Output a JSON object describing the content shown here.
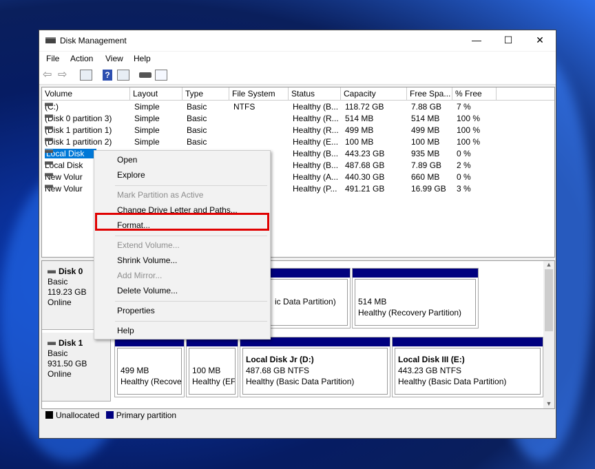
{
  "window": {
    "title": "Disk Management",
    "minimize": "—",
    "maximize": "☐",
    "close": "✕"
  },
  "menu": [
    "File",
    "Action",
    "View",
    "Help"
  ],
  "toolbar": [
    "back-icon",
    "forward-icon",
    "show-hide-tree-icon",
    "help-icon",
    "show-hide-action-pane-icon",
    "connect-icon",
    "properties-icon"
  ],
  "columns": [
    "Volume",
    "Layout",
    "Type",
    "File System",
    "Status",
    "Capacity",
    "Free Spa...",
    "% Free"
  ],
  "volumes": [
    [
      "(C:)",
      "Simple",
      "Basic",
      "NTFS",
      "Healthy (B...",
      "118.72 GB",
      "7.88 GB",
      "7 %"
    ],
    [
      "(Disk 0 partition 3)",
      "Simple",
      "Basic",
      "",
      "Healthy (R...",
      "514 MB",
      "514 MB",
      "100 %"
    ],
    [
      "(Disk 1 partition 1)",
      "Simple",
      "Basic",
      "",
      "Healthy (R...",
      "499 MB",
      "499 MB",
      "100 %"
    ],
    [
      "(Disk 1 partition 2)",
      "Simple",
      "Basic",
      "",
      "Healthy (E...",
      "100 MB",
      "100 MB",
      "100 %"
    ],
    [
      "Local Disk",
      "",
      "",
      "",
      "Healthy (B...",
      "443.23 GB",
      "935 MB",
      "0 %"
    ],
    [
      "Local Disk",
      "",
      "",
      "",
      "Healthy (B...",
      "487.68 GB",
      "7.89 GB",
      "2 %"
    ],
    [
      "New Volur",
      "",
      "",
      "",
      "Healthy (A...",
      "440.30 GB",
      "660 MB",
      "0 %"
    ],
    [
      "New Volur",
      "",
      "",
      "",
      "Healthy (P...",
      "491.21 GB",
      "16.99 GB",
      "3 %"
    ]
  ],
  "disks": [
    {
      "name": "Disk 0",
      "type": "Basic",
      "size": "119.23 GB",
      "status": "Online",
      "partitions": [
        {
          "title": "",
          "size": "",
          "status": "ic Data Partition)"
        },
        {
          "title": "",
          "size": "514 MB",
          "status": "Healthy (Recovery Partition)"
        }
      ]
    },
    {
      "name": "Disk 1",
      "type": "Basic",
      "size": "931.50 GB",
      "status": "Online",
      "partitions": [
        {
          "title": "",
          "size": "499 MB",
          "status": "Healthy (Recover"
        },
        {
          "title": "",
          "size": "100 MB",
          "status": "Healthy (EFI"
        },
        {
          "title": "Local Disk Jr  (D:)",
          "size": "487.68 GB NTFS",
          "status": "Healthy (Basic Data Partition)"
        },
        {
          "title": "Local Disk III  (E:)",
          "size": "443.23 GB NTFS",
          "status": "Healthy (Basic Data Partition)"
        }
      ]
    }
  ],
  "legend": [
    {
      "label": "Unallocated",
      "color": "#000000"
    },
    {
      "label": "Primary partition",
      "color": "#00007f"
    }
  ],
  "context_menu": [
    {
      "label": "Open",
      "enabled": true
    },
    {
      "label": "Explore",
      "enabled": true
    },
    {
      "label": "Mark Partition as Active",
      "enabled": false
    },
    {
      "label": "Change Drive Letter and Paths...",
      "enabled": true
    },
    {
      "label": "Format...",
      "enabled": true,
      "highlighted": true
    },
    {
      "label": "Extend Volume...",
      "enabled": false
    },
    {
      "label": "Shrink Volume...",
      "enabled": true
    },
    {
      "label": "Add Mirror...",
      "enabled": false
    },
    {
      "label": "Delete Volume...",
      "enabled": true
    },
    {
      "label": "Properties",
      "enabled": true
    },
    {
      "label": "Help",
      "enabled": true
    }
  ],
  "colors": {
    "selection": "#0078d7",
    "primary": "#00007f",
    "highlight_box": "#e00000"
  }
}
